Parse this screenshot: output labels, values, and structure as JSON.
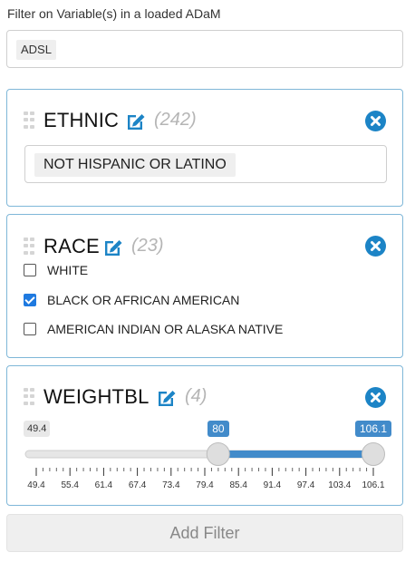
{
  "header": {
    "label": "Filter on Variable(s) in a loaded ADaM"
  },
  "dataset": {
    "selected": "ADSL"
  },
  "filters": {
    "ethnic": {
      "name": "ETHNIC",
      "count": "(242)",
      "selected_value": "NOT HISPANIC OR LATINO"
    },
    "race": {
      "name": "RACE",
      "count": "(23)",
      "options": [
        {
          "label": "WHITE",
          "checked": false
        },
        {
          "label": "BLACK OR AFRICAN AMERICAN",
          "checked": true
        },
        {
          "label": "AMERICAN INDIAN OR ALASKA NATIVE",
          "checked": false
        }
      ]
    },
    "weightbl": {
      "name": "WEIGHTBL",
      "count": "(4)",
      "min_label": "49.4",
      "low_value": "80",
      "high_value": "106.1",
      "range_min": 49.4,
      "range_max": 106.1,
      "low": 80,
      "high": 106.1,
      "ticks": [
        "49.4",
        "55.4",
        "61.4",
        "67.4",
        "73.4",
        "79.4",
        "85.4",
        "91.4",
        "97.4",
        "103.4",
        "106.1"
      ]
    }
  },
  "add_filter": {
    "label": "Add Filter"
  },
  "colors": {
    "accent": "#1c84c6",
    "slider": "#428bca",
    "card_border": "#7fb7d8"
  },
  "icons": {
    "edit": "edit-icon",
    "close": "close-icon",
    "drag": "drag-handle-icon"
  }
}
